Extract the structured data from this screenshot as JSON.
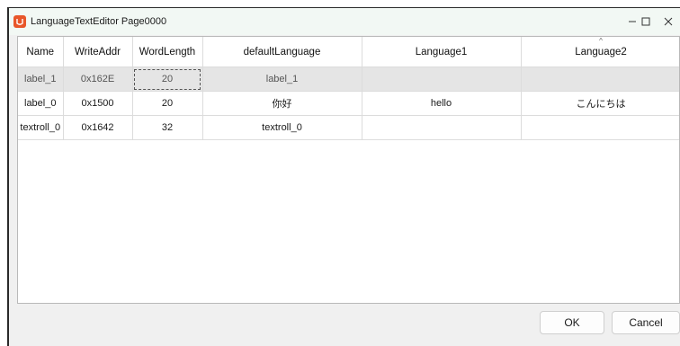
{
  "window": {
    "title": "LanguageTextEditor Page0000",
    "controls": {
      "minimize": "—",
      "maximize": "☐",
      "close": "✕"
    }
  },
  "grid": {
    "columns": [
      "Name",
      "WriteAddr",
      "WordLength",
      "defaultLanguage",
      "Language1",
      "Language2"
    ],
    "rows": [
      [
        "label_1",
        "0x162E",
        "20",
        "label_1",
        "",
        ""
      ],
      [
        "label_0",
        "0x1500",
        "20",
        "你好",
        "hello",
        "こんにちは"
      ],
      [
        "textroll_0",
        "0x1642",
        "32",
        "textroll_0",
        "",
        ""
      ]
    ],
    "selected_row": 0,
    "sort_caret": "^"
  },
  "buttons": {
    "ok": "OK",
    "cancel": "Cancel"
  },
  "colors": {
    "app_icon": "#e8562a",
    "selected_row": "#e5e5e5"
  }
}
